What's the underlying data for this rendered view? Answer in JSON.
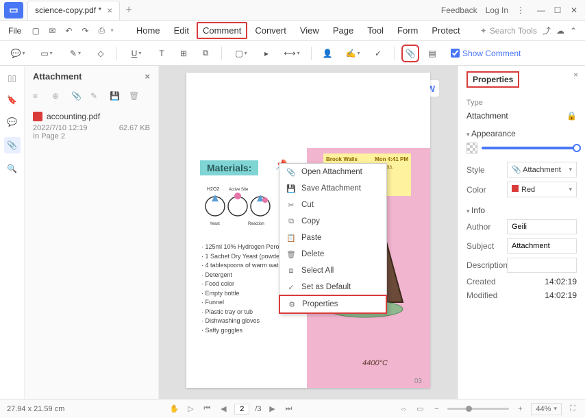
{
  "titlebar": {
    "tab_name": "science-copy.pdf *",
    "feedback": "Feedback",
    "login": "Log In"
  },
  "menubar": {
    "file": "File",
    "items": [
      "Home",
      "Edit",
      "Comment",
      "Convert",
      "View",
      "Page",
      "Tool",
      "Form",
      "Protect"
    ],
    "active_index": 2,
    "search_placeholder": "Search Tools"
  },
  "toolbar": {
    "show_comment": "Show Comment"
  },
  "attach_panel": {
    "title": "Attachment",
    "file_name": "accounting.pdf",
    "file_date": "2022/7/10 12:19",
    "file_size": "62.67 KB",
    "file_page": "In Page 2"
  },
  "document": {
    "materials_title": "Materials:",
    "sticky_author": "Brook Walls",
    "sticky_time": "Mon 4:41 PM",
    "sticky_text": "slatable and Sen est. h gas.",
    "mol_labels": {
      "h2o2": "H2O2",
      "active": "Active Site",
      "yeast": "Yeast",
      "reaction": "Reaction"
    },
    "materials": [
      "125ml 10% Hydrogen Peroxid",
      "1 Sachet Dry Yeast (powder)",
      "4 tablespoons of warm water",
      "Detergent",
      "Food color",
      "Empty bottle",
      "Funnel",
      "Plastic tray or tub",
      "Dishwashing gloves",
      "Safty goggles"
    ],
    "temperature": "4400°C",
    "page_num": "03"
  },
  "context_menu": {
    "items": [
      "Open Attachment",
      "Save Attachment",
      "Cut",
      "Copy",
      "Paste",
      "Delete",
      "Select All",
      "Set as Default",
      "Properties"
    ],
    "highlighted_index": 8
  },
  "properties": {
    "title": "Properties",
    "type_label": "Type",
    "type_value": "Attachment",
    "appearance_label": "Appearance",
    "style_label": "Style",
    "style_value": "Attachment",
    "color_label": "Color",
    "color_value": "Red",
    "color_hex": "#d93a3a",
    "info_label": "Info",
    "author_label": "Author",
    "author_value": "Geili",
    "subject_label": "Subject",
    "subject_value": "Attachment",
    "description_label": "Description",
    "description_value": "",
    "created_label": "Created",
    "created_value": "14:02:19",
    "modified_label": "Modified",
    "modified_value": "14:02:19"
  },
  "statusbar": {
    "dimensions": "27.94 x 21.59 cm",
    "page_current": "2",
    "page_total": "/3",
    "zoom_value": "44%"
  }
}
